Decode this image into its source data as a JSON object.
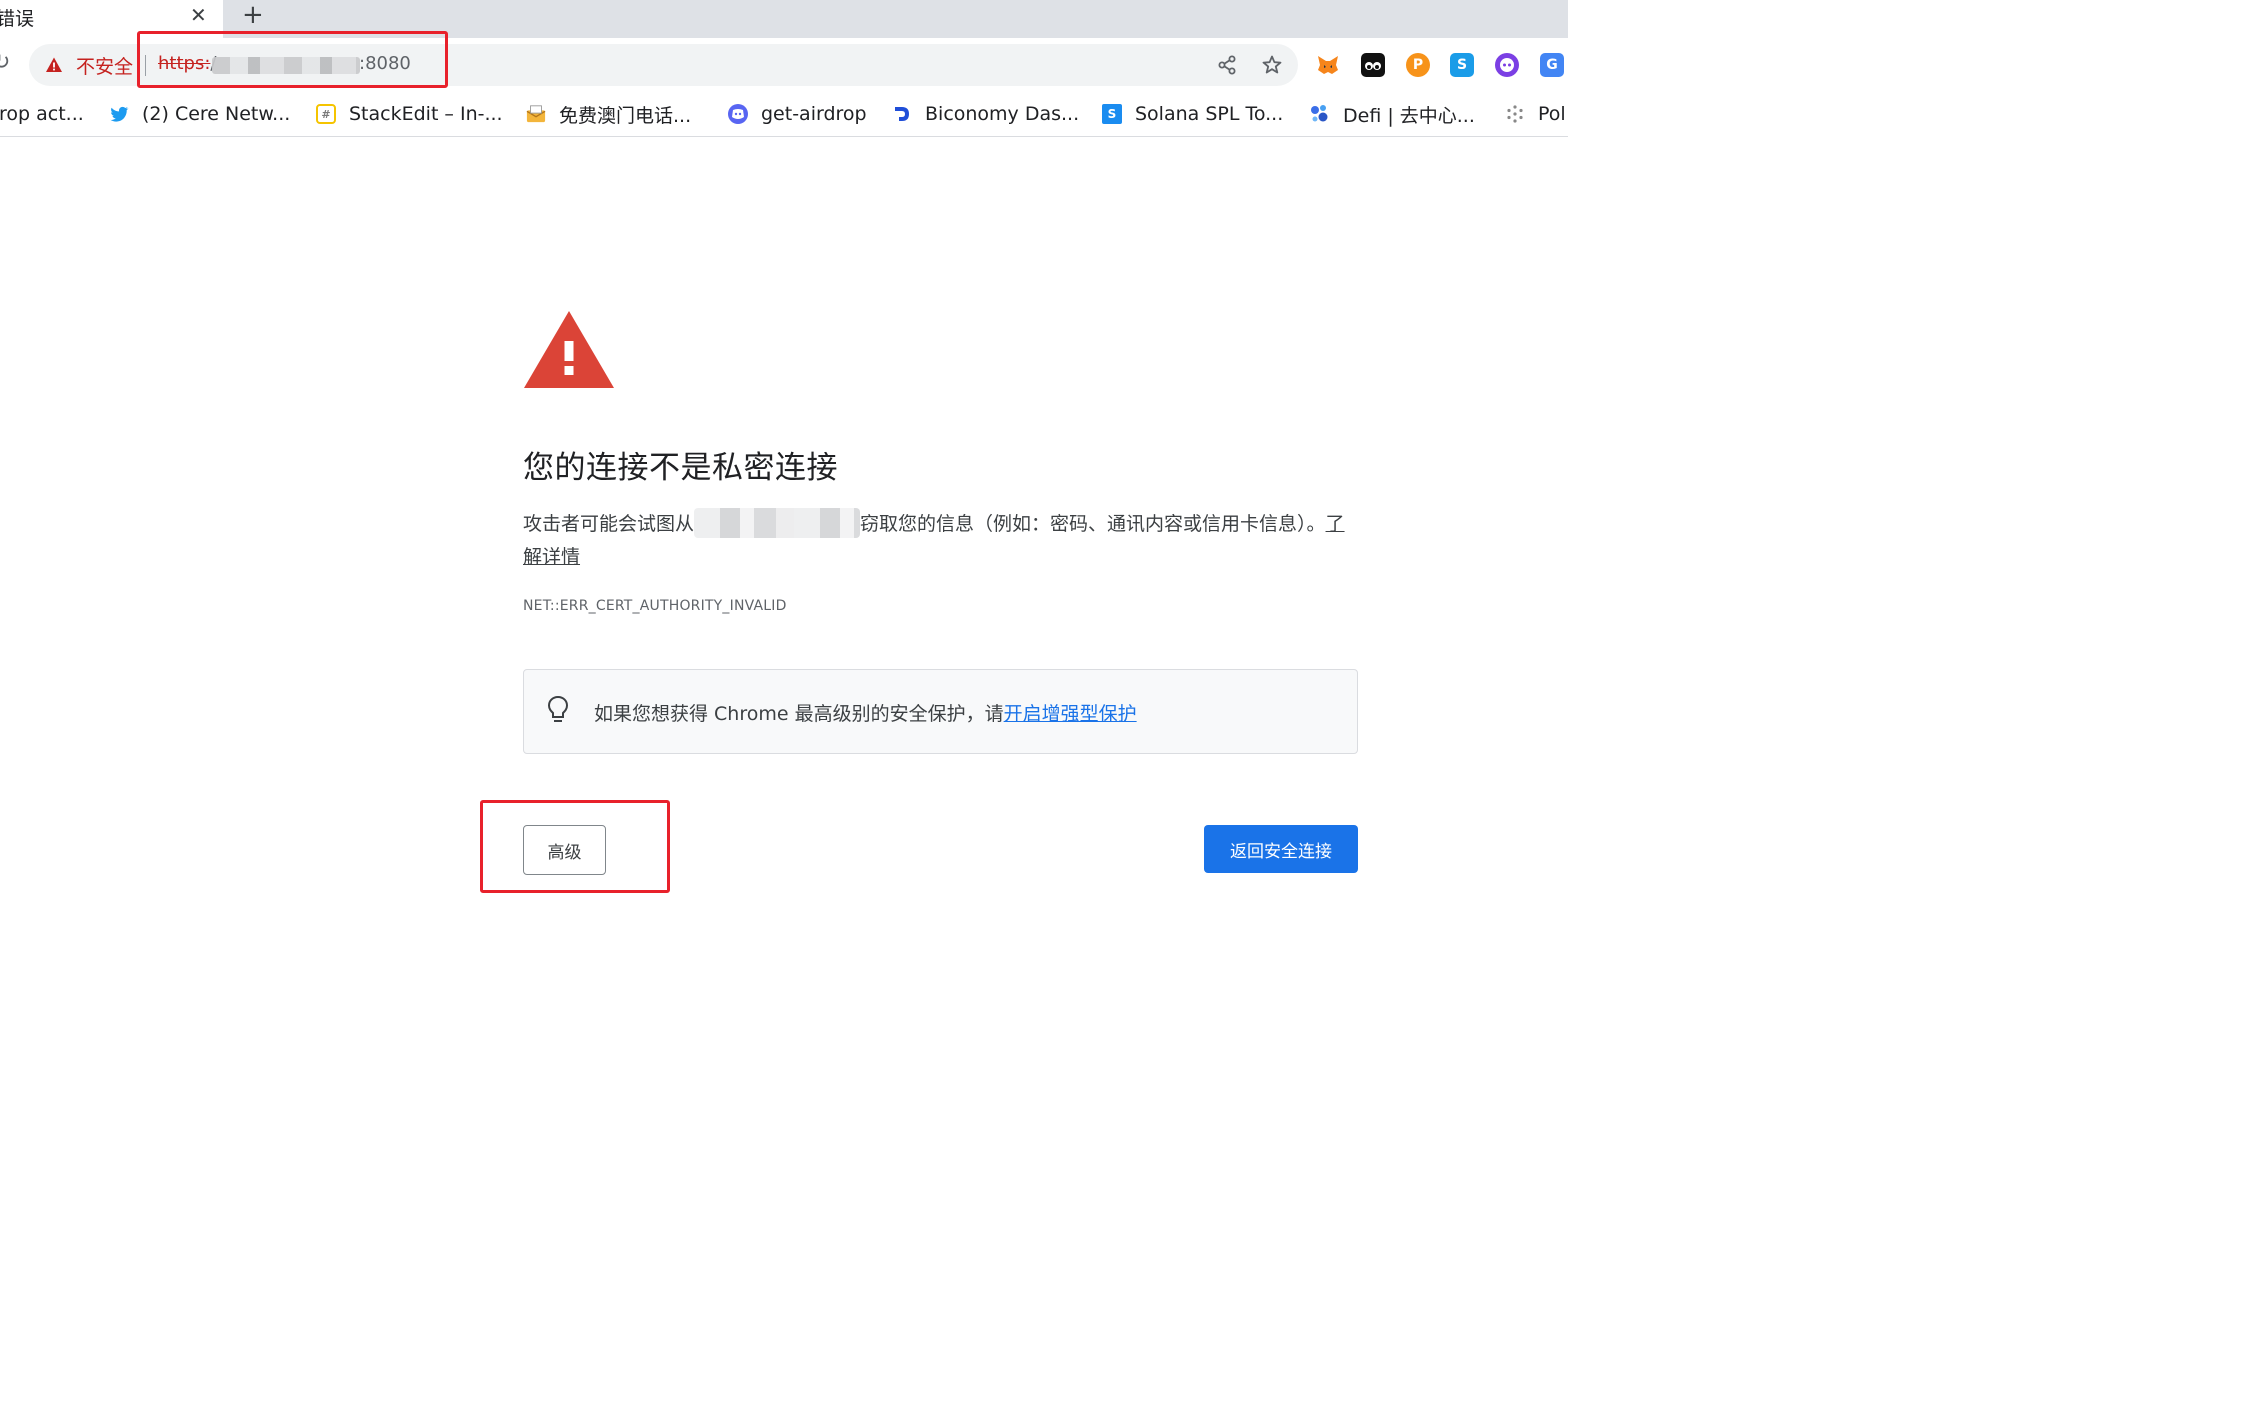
{
  "browser": {
    "tab": {
      "title": "错误",
      "close_glyph": "✕"
    },
    "new_tab_glyph": "+",
    "reload_glyph": "↻",
    "omnibox": {
      "security_label": "不安全",
      "scheme": "https:",
      "slash": "/",
      "port": ":8080",
      "warning_color": "#c5221f"
    },
    "extensions": [
      {
        "icon": "metamask-fox-icon",
        "color": "#f6851b"
      },
      {
        "icon": "eyes-extension-icon",
        "color": "#111111"
      },
      {
        "icon": "p-coin-icon",
        "color": "#f7931a",
        "glyph": "P"
      },
      {
        "icon": "s-extension-icon",
        "color": "#1a9ce8",
        "glyph": "S"
      },
      {
        "icon": "purple-face-icon",
        "color": "#7b3fe4"
      },
      {
        "icon": "google-translate-icon",
        "color": "#4285f4",
        "glyph": "G"
      }
    ]
  },
  "bookmarks": [
    {
      "label": "rop act...",
      "icon": null
    },
    {
      "label": "(2) Cere Netw...",
      "icon": "twitter-icon"
    },
    {
      "label": "StackEdit – In-...",
      "icon": "stackedit-icon"
    },
    {
      "label": "免费澳门电话...",
      "icon": "envelope-icon"
    },
    {
      "label": "get-airdrop",
      "icon": "discord-icon"
    },
    {
      "label": "Biconomy Das...",
      "icon": "biconomy-icon"
    },
    {
      "label": "Solana SPL To...",
      "icon": "solana-s-icon"
    },
    {
      "label": "Defi | 去中心...",
      "icon": "defi-dots-icon"
    },
    {
      "label": "Pol",
      "icon": "polkadot-icon"
    }
  ],
  "interstitial": {
    "heading": "您的连接不是私密连接",
    "body_before": "攻击者可能会试图从",
    "body_after": "窃取您的信息（例如：密码、通讯内容或信用卡信息）。",
    "learn_more": "了解详情",
    "error_code": "NET::ERR_CERT_AUTHORITY_INVALID",
    "promo_text": "如果您想获得 Chrome 最高级别的安全保护，请",
    "promo_link": "开启增强型保护",
    "advanced_button": "高级",
    "back_button": "返回安全连接",
    "accent_color": "#1a73e8",
    "danger_color": "#db4437"
  },
  "annotations": {
    "color": "#e8212b"
  }
}
